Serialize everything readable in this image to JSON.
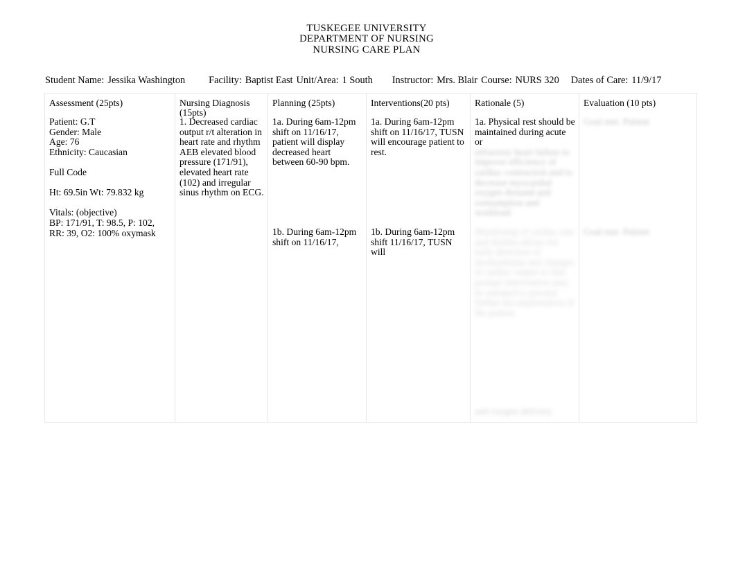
{
  "document": {
    "title_lines": [
      "TUSKEGEE UNIVERSITY",
      "DEPARTMENT OF NURSING",
      "NURSING CARE PLAN"
    ]
  },
  "header_fields": {
    "student_name_label": "Student Name:",
    "student_name_value": "Jessika Washington",
    "facility_label": "Facility:",
    "facility_value": "Baptist East",
    "unit_area_label": "Unit/Area:",
    "unit_area_value": "1 South",
    "instructor_label": "Instructor:",
    "instructor_value": "Mrs. Blair",
    "course_label": "Course:",
    "course_value": "NURS 320",
    "dates_of_care_label": "Dates of Care:",
    "dates_of_care_value": "11/9/17"
  },
  "table": {
    "columns": [
      {
        "key": "assessment",
        "header_line1": "Assessment   (25pts)",
        "header_line2": ""
      },
      {
        "key": "diagnosis",
        "header_line1": "Nursing Diagnosis",
        "header_line2": "(15pts)"
      },
      {
        "key": "planning",
        "header_line1": "Planning    (25pts)",
        "header_line2": ""
      },
      {
        "key": "interventions",
        "header_line1": "Interventions(20 pts)",
        "header_line2": ""
      },
      {
        "key": "rationale",
        "header_line1": "Rationale (5)",
        "header_line2": ""
      },
      {
        "key": "evaluation",
        "header_line1": "Evaluation   (10 pts)",
        "header_line2": ""
      }
    ],
    "assessment": {
      "patient": "Patient:   G.T",
      "gender": "Gender:   Male",
      "age": "Age: 76",
      "ethnicity": "Ethnicity:   Caucasian",
      "code_status": "Full Code",
      "height_weight": "Ht:  69.5in          Wt:  79.832 kg",
      "vitals_label": "Vitals: (objective)",
      "vitals_value": "BP: 171/91, T: 98.5, P: 102, RR: 39, O2: 100% oxymask"
    },
    "diagnosis": {
      "item_1": "1. Decreased cardiac output r/t alteration in heart rate and rhythm AEB elevated blood pressure (171/91), elevated heart rate (102) and irregular sinus rhythm on ECG."
    },
    "planning": {
      "goal_1a": "1a. During 6am-12pm shift on 11/16/17, patient will display decreased heart between 60-90 bpm.",
      "goal_1b": "1b. During 6am-12pm shift on 11/16/17,"
    },
    "interventions": {
      "item_1a": "1a. During 6am-12pm shift on 11/16/17, TUSN will encourage patient to rest.",
      "item_1b": "1b. During 6am-12pm shift 11/16/17, TUSN will"
    },
    "rationale": {
      "item_1a_visible": "1a. Physical rest should be maintained during acute or",
      "item_1a_illegible": "refractory heart failure to improve efficiency of cardiac contraction and to decrease myocardial oxygen demand and consumption and workload.",
      "item_1b_illegible": "Monitoring of cardiac rate and rhythm allows for early detection of dysrhythmias and changes in cardiac output so that prompt intervention may be initiated to prevent further decompensation of the patient.",
      "item_bottom_illegible": "and oxygen delivery."
    },
    "evaluation": {
      "item_1a_illegible": "Goal met.  Patient",
      "item_1b_illegible": "Goal met.  Patient"
    }
  }
}
